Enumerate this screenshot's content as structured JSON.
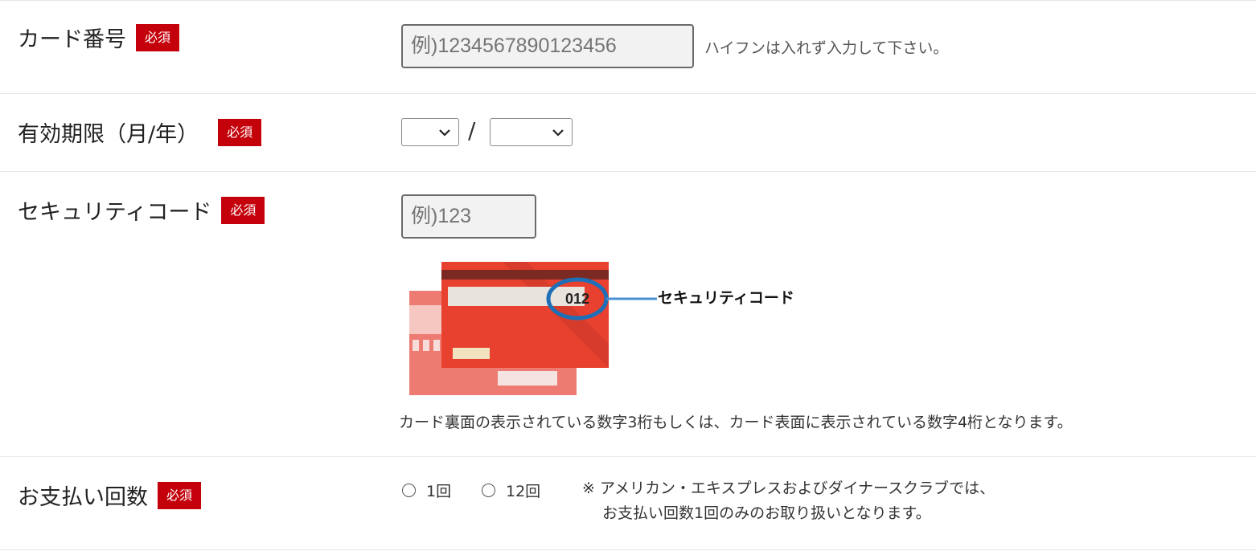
{
  "required_badge": "必須",
  "card_number": {
    "label": "カード番号",
    "placeholder": "例)1234567890123456",
    "hint": "ハイフンは入れず入力して下さい。"
  },
  "expiry": {
    "label": "有効期限（月/年）",
    "month_value": "",
    "separator": "/",
    "year_value": ""
  },
  "security_code": {
    "label": "セキュリティコード",
    "placeholder": "例)123",
    "illustration": {
      "code_digits": "012",
      "callout_label": "セキュリティコード"
    },
    "note": "カード裏面の表示されている数字3桁もしくは、カード表面に表示されている数字4桁となります。"
  },
  "installments": {
    "label": "お支払い回数",
    "options": [
      "1回",
      "12回"
    ],
    "remark_line1": "※ アメリカン・エキスプレスおよびダイナースクラブでは、",
    "remark_line2": "お支払い回数1回のみのお取り扱いとなります。"
  },
  "colors": {
    "badge_red": "#c4000b",
    "card_red": "#e8412f",
    "highlight_blue": "#1d6fb8"
  }
}
